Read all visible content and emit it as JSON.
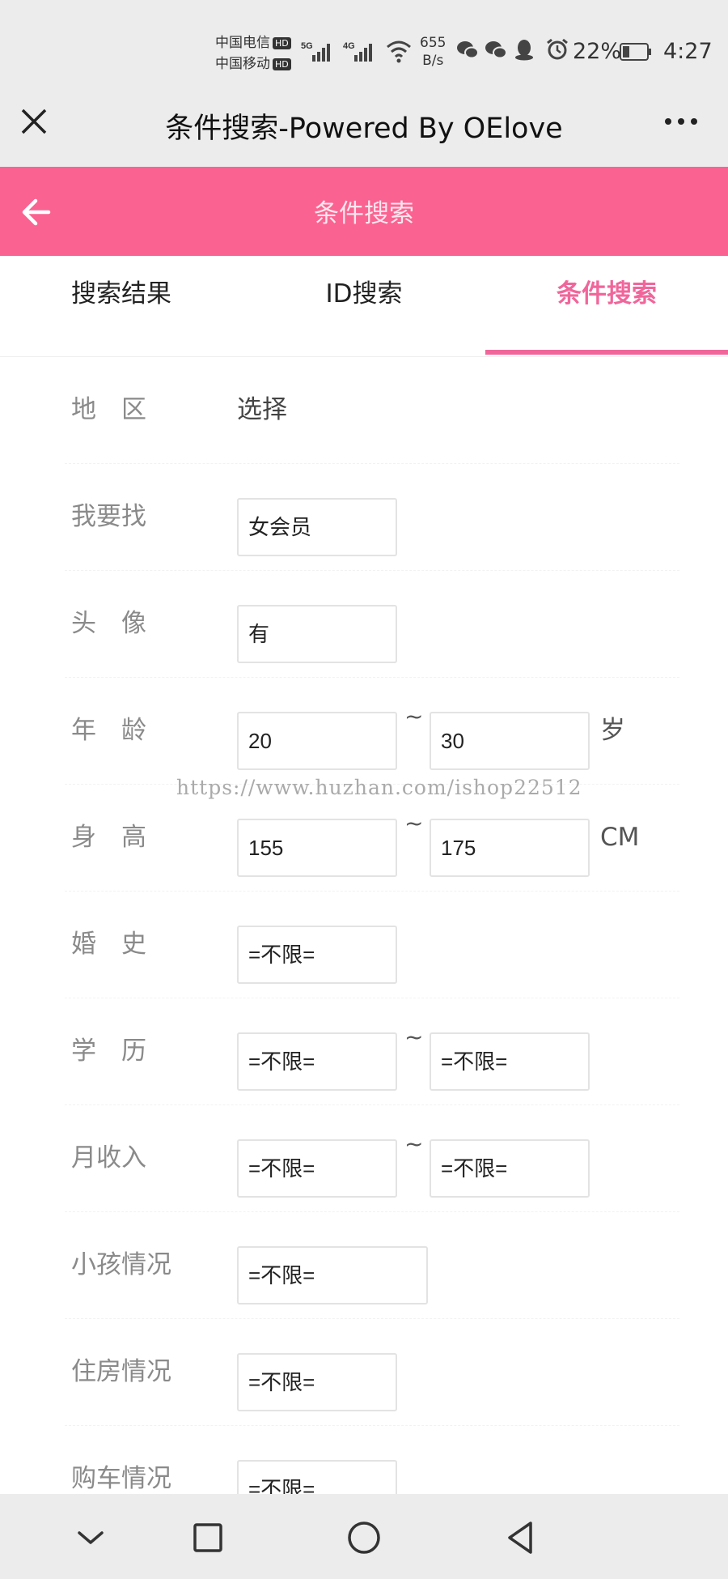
{
  "status_bar": {
    "carrier1": "中国电信",
    "carrier2": "中国移动",
    "hd": "HD",
    "net1": "5G",
    "net2": "4G",
    "speed_value": "655",
    "speed_unit": "B/s",
    "battery": "22%",
    "time": "4:27"
  },
  "titlebar": {
    "title": "条件搜索-Powered By OElove"
  },
  "header": {
    "title": "条件搜索"
  },
  "tabs": [
    {
      "label": "搜索结果"
    },
    {
      "label": "ID搜索"
    },
    {
      "label": "条件搜索"
    }
  ],
  "form": {
    "region": {
      "label": "地　区",
      "value": "选择"
    },
    "seeking": {
      "label": "我要找",
      "value": "女会员"
    },
    "avatar": {
      "label": "头　像",
      "value": "有"
    },
    "age": {
      "label": "年　龄",
      "min": "20",
      "max": "30",
      "unit": "岁"
    },
    "height": {
      "label": "身　高",
      "min": "155",
      "max": "175",
      "unit": "CM"
    },
    "marriage": {
      "label": "婚　史",
      "value": "=不限="
    },
    "education": {
      "label": "学　历",
      "min": "=不限=",
      "max": "=不限="
    },
    "income": {
      "label": "月收入",
      "min": "=不限=",
      "max": "=不限="
    },
    "children": {
      "label": "小孩情况",
      "value": "=不限="
    },
    "housing": {
      "label": "住房情况",
      "value": "=不限="
    },
    "car": {
      "label": "购车情况",
      "value": "=不限="
    },
    "tilde": "~"
  },
  "watermark": "https://www.huzhan.com/ishop22512",
  "colors": {
    "accent": "#fa6391",
    "tab_active": "#f0669a"
  }
}
